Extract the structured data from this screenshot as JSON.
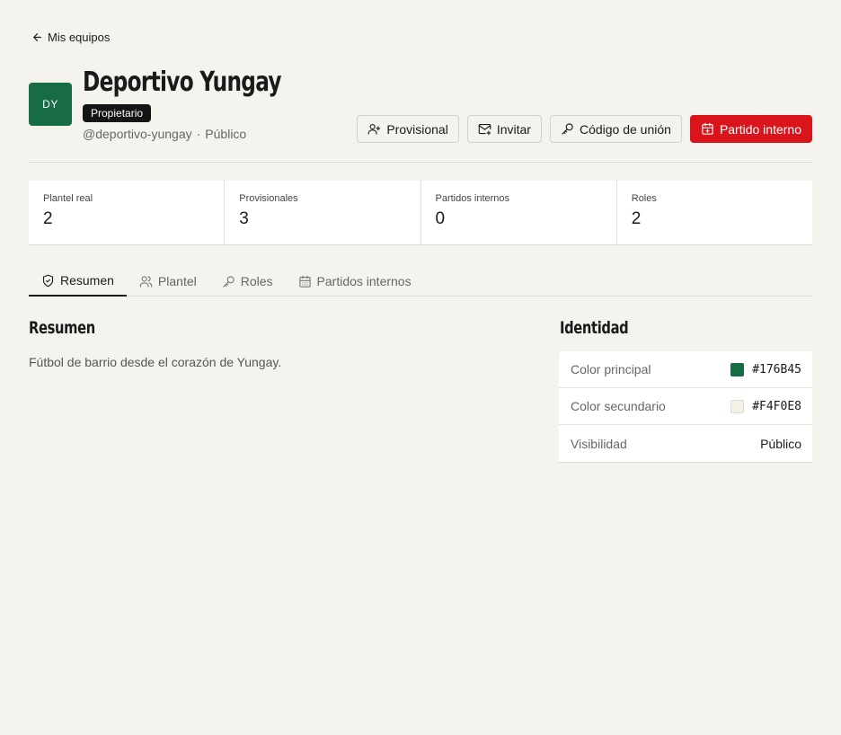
{
  "nav": {
    "back_label": "Mis equipos"
  },
  "team": {
    "initials": "DY",
    "name": "Deportivo Yungay",
    "role": "Propietario",
    "handle": "@deportivo-yungay",
    "separator": "·",
    "visibility": "Público",
    "avatar_color": "#176B45"
  },
  "actions": {
    "provisional": "Provisional",
    "invite": "Invitar",
    "join_code": "Código de unión",
    "internal_match": "Partido interno",
    "primary_color": "#D9141B"
  },
  "stats": [
    {
      "label": "Plantel real",
      "value": "2"
    },
    {
      "label": "Provisionales",
      "value": "3"
    },
    {
      "label": "Partidos internos",
      "value": "0"
    },
    {
      "label": "Roles",
      "value": "2"
    }
  ],
  "tabs": [
    {
      "label": "Resumen",
      "icon": "shield-icon",
      "active": true
    },
    {
      "label": "Plantel",
      "icon": "users-icon"
    },
    {
      "label": "Roles",
      "icon": "key-icon"
    },
    {
      "label": "Partidos internos",
      "icon": "calendar-icon"
    }
  ],
  "summary": {
    "title": "Resumen",
    "description": "Fútbol de barrio desde el corazón de Yungay."
  },
  "identity": {
    "title": "Identidad",
    "rows": [
      {
        "label": "Color principal",
        "value": "#176B45",
        "swatch": "#176B45"
      },
      {
        "label": "Color secundario",
        "value": "#F4F0E8",
        "swatch": "#F4F0E8"
      },
      {
        "label": "Visibilidad",
        "value": "Público"
      }
    ]
  }
}
